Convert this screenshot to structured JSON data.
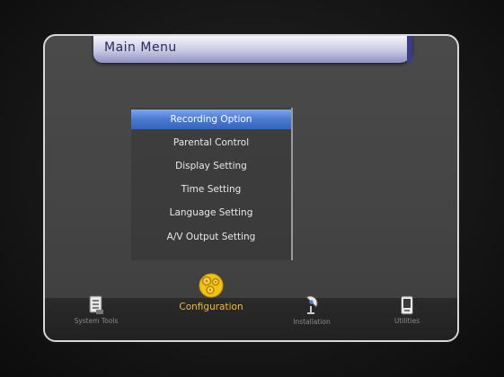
{
  "window": {
    "title": "Main Menu"
  },
  "menu": {
    "items": [
      {
        "label": "Recording Option",
        "selected": true
      },
      {
        "label": "Parental Control",
        "selected": false
      },
      {
        "label": "Display Setting",
        "selected": false
      },
      {
        "label": "Time Setting",
        "selected": false
      },
      {
        "label": "Language Setting",
        "selected": false
      },
      {
        "label": "A/V Output Setting",
        "selected": false
      }
    ]
  },
  "nav": {
    "items": [
      {
        "label": "System Tools",
        "icon": "document-icon",
        "active": false
      },
      {
        "label": "Configuration",
        "icon": "gear-cluster-icon",
        "active": true
      },
      {
        "label": "Installation",
        "icon": "satellite-dish-icon",
        "active": false
      },
      {
        "label": "Utilities",
        "icon": "handheld-device-icon",
        "active": false
      }
    ]
  },
  "colors": {
    "selection": "#4a7ad0",
    "active_label": "#f3b93a",
    "frame_border": "#d8d8d8"
  }
}
